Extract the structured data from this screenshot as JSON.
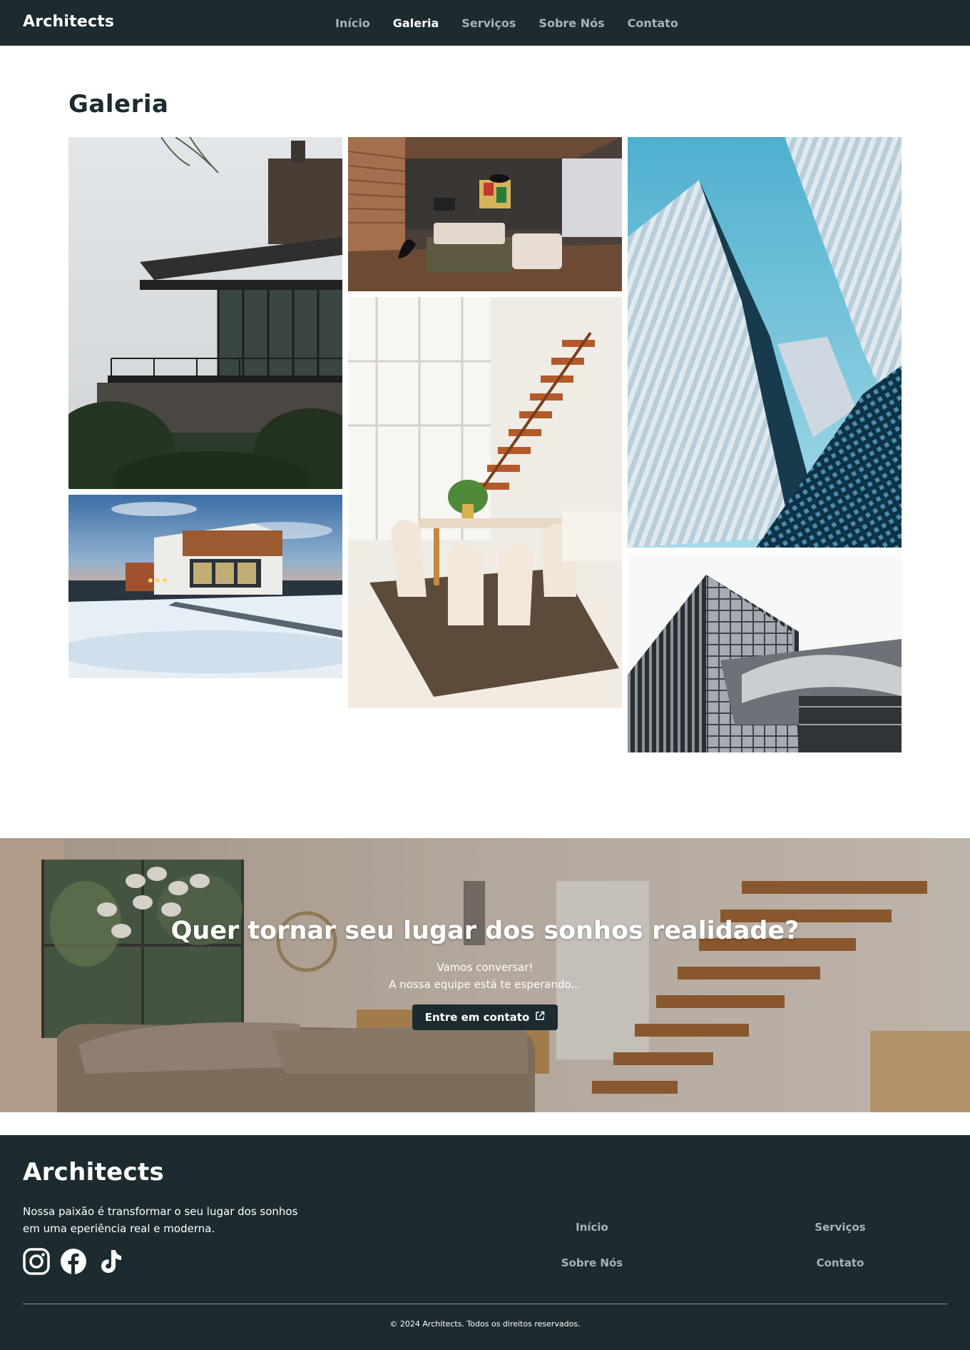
{
  "nav": {
    "brand": "Architects",
    "links": [
      {
        "label": "Início",
        "active": false
      },
      {
        "label": "Galeria",
        "active": true
      },
      {
        "label": "Serviços",
        "active": false
      },
      {
        "label": "Sobre Nós",
        "active": false
      },
      {
        "label": "Contato",
        "active": false
      }
    ]
  },
  "gallery": {
    "title": "Galeria",
    "photos": [
      {
        "subject": "modern house with cantilevered balconies among trees"
      },
      {
        "subject": "living room interior with wooden floor and blinds"
      },
      {
        "subject": "blue glass skyscrapers viewed from below"
      },
      {
        "subject": "modern house in snow at dusk"
      },
      {
        "subject": "dining room with floating wooden staircase"
      },
      {
        "subject": "glass office building facade"
      }
    ]
  },
  "cta": {
    "title": "Quer tornar seu lugar dos sonhos realidade?",
    "line1": "Vamos conversar!",
    "line2": "A nossa equipe está te esperando...",
    "button_label": "Entre em contato",
    "button_icon": "external-link-icon",
    "background_subject": "modern living room with sofa, kitchen and wooden staircase"
  },
  "footer": {
    "brand": "Architects",
    "description_line1": "Nossa paixão é transformar o seu lugar dos sonhos",
    "description_line2": "em uma eperiência real e moderna.",
    "social_icons": [
      "instagram-icon",
      "facebook-icon",
      "tiktok-icon"
    ],
    "links": {
      "inicio": "Início",
      "servicos": "Serviços",
      "sobre": "Sobre Nós",
      "contato": "Contato"
    },
    "copyright": "© 2024 Architects. Todos os direitos reservados."
  },
  "colors": {
    "primary_dark": "#1c2b30",
    "nav_link_muted": "#aab3b6",
    "white": "#ffffff"
  }
}
